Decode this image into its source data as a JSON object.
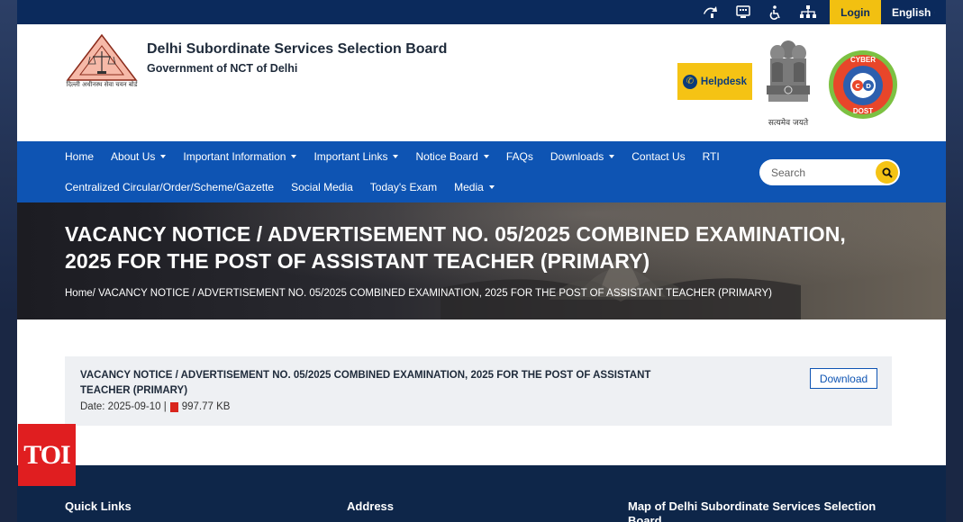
{
  "topbar": {
    "icons": [
      "screen-reader-icon",
      "keyboard-icon",
      "accessibility-icon",
      "sitemap-icon"
    ],
    "login_label": "Login",
    "language": "English"
  },
  "header": {
    "org_name": "Delhi Subordinate Services Selection Board",
    "org_sub": "Government of NCT of Delhi",
    "logo_caption": "दिल्ली अधीनस्थ सेवा चयन बोर्ड",
    "helpdesk_label": "Helpdesk",
    "emblem_caption": "सत्यमेव जयते",
    "cyber_badge": [
      "CYBER",
      "DOST"
    ]
  },
  "nav": {
    "row1": [
      {
        "label": "Home",
        "dropdown": false
      },
      {
        "label": "About Us",
        "dropdown": true
      },
      {
        "label": "Important Information",
        "dropdown": true
      },
      {
        "label": "Important Links",
        "dropdown": true
      },
      {
        "label": "Notice Board",
        "dropdown": true
      },
      {
        "label": "FAQs",
        "dropdown": false
      },
      {
        "label": "Downloads",
        "dropdown": true
      },
      {
        "label": "Contact Us",
        "dropdown": false
      },
      {
        "label": "RTI",
        "dropdown": false
      }
    ],
    "row2": [
      {
        "label": "Centralized Circular/Order/Scheme/Gazette",
        "dropdown": false
      },
      {
        "label": "Social Media",
        "dropdown": false
      },
      {
        "label": "Today's Exam",
        "dropdown": false
      },
      {
        "label": "Media",
        "dropdown": true
      }
    ],
    "search_placeholder": "Search"
  },
  "hero": {
    "title": "VACANCY NOTICE / ADVERTISEMENT NO. 05/2025 COMBINED EXAMINATION, 2025 FOR THE POST OF ASSISTANT TEACHER (PRIMARY)",
    "breadcrumb_home": "Home/",
    "breadcrumb_current": " VACANCY NOTICE / ADVERTISEMENT NO. 05/2025 COMBINED EXAMINATION, 2025 FOR THE POST OF ASSISTANT TEACHER (PRIMARY)"
  },
  "notice": {
    "title": "VACANCY NOTICE / ADVERTISEMENT NO. 05/2025 COMBINED EXAMINATION, 2025 FOR THE POST OF ASSISTANT TEACHER (PRIMARY)",
    "date_text": "Date: 2025-09-10 |",
    "file_size": "997.77 KB",
    "download_label": "Download"
  },
  "footer": {
    "quick_links": "Quick Links",
    "address": "Address",
    "map_title": "Map of Delhi Subordinate Services Selection Board"
  },
  "watermark": "TOI",
  "colors": {
    "topbar": "#0b2a5c",
    "nav": "#0e54b3",
    "accent_yellow": "#f5c314",
    "footer": "#0e2649",
    "card": "#eef0f3"
  }
}
